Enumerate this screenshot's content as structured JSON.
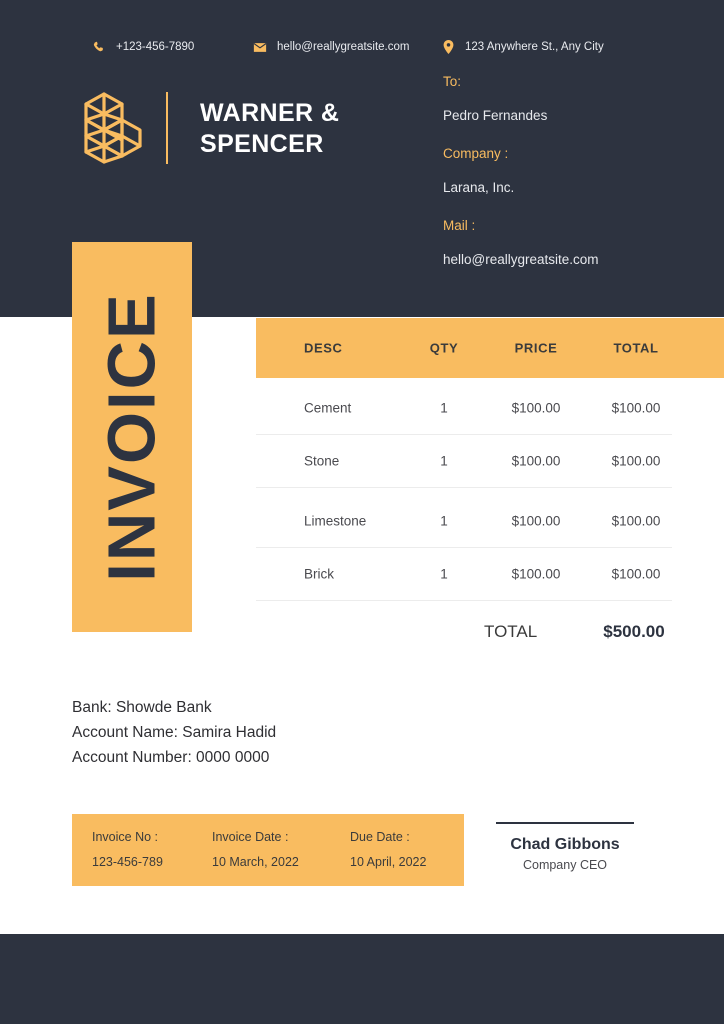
{
  "colors": {
    "navy": "#2d3340",
    "orange": "#f9bc60",
    "white": "#ffffff",
    "text_light": "#e7e9ed",
    "text_body": "#4a4a4f"
  },
  "header": {
    "logo_icon": "isometric-blocks-logo-icon",
    "brand_line1": "WARNER &",
    "brand_line2": "SPENCER",
    "to_label": "To:",
    "to_value": "Pedro Fernandes",
    "company_label": "Company :",
    "company_value": "Larana, Inc.",
    "mail_label": "Mail :",
    "mail_value": "hello@reallygreatsite.com"
  },
  "invoice_title": "INVOICE",
  "table": {
    "headers": [
      "DESC",
      "QTY",
      "PRICE",
      "TOTAL"
    ],
    "rows": [
      {
        "desc": "Cement",
        "qty": "1",
        "price": "$100.00",
        "total": "$100.00"
      },
      {
        "desc": "Stone",
        "qty": "1",
        "price": "$100.00",
        "total": "$100.00"
      },
      {
        "desc": "Limestone",
        "qty": "1",
        "price": "$100.00",
        "total": "$100.00"
      },
      {
        "desc": "Brick",
        "qty": "1",
        "price": "$100.00",
        "total": "$100.00"
      }
    ],
    "total_label": "TOTAL",
    "total_amount": "$500.00"
  },
  "bank": {
    "line1": "Bank: Showde Bank",
    "line2": "Account Name: Samira Hadid",
    "line3": "Account Number: 0000 0000"
  },
  "meta": {
    "invoice_no_label": "Invoice No :",
    "invoice_no_value": "123-456-789",
    "invoice_date_label": "Invoice Date :",
    "invoice_date_value": "10 March, 2022",
    "due_date_label": "Due Date :",
    "due_date_value": "10 April, 2022"
  },
  "signature": {
    "name": "Chad Gibbons",
    "title": "Company CEO"
  },
  "footer": {
    "phone_icon": "phone-icon",
    "phone": "+123-456-7890",
    "mail_icon": "envelope-icon",
    "mail": "hello@reallygreatsite.com",
    "location_icon": "map-pin-icon",
    "address": "123 Anywhere St., Any City"
  }
}
